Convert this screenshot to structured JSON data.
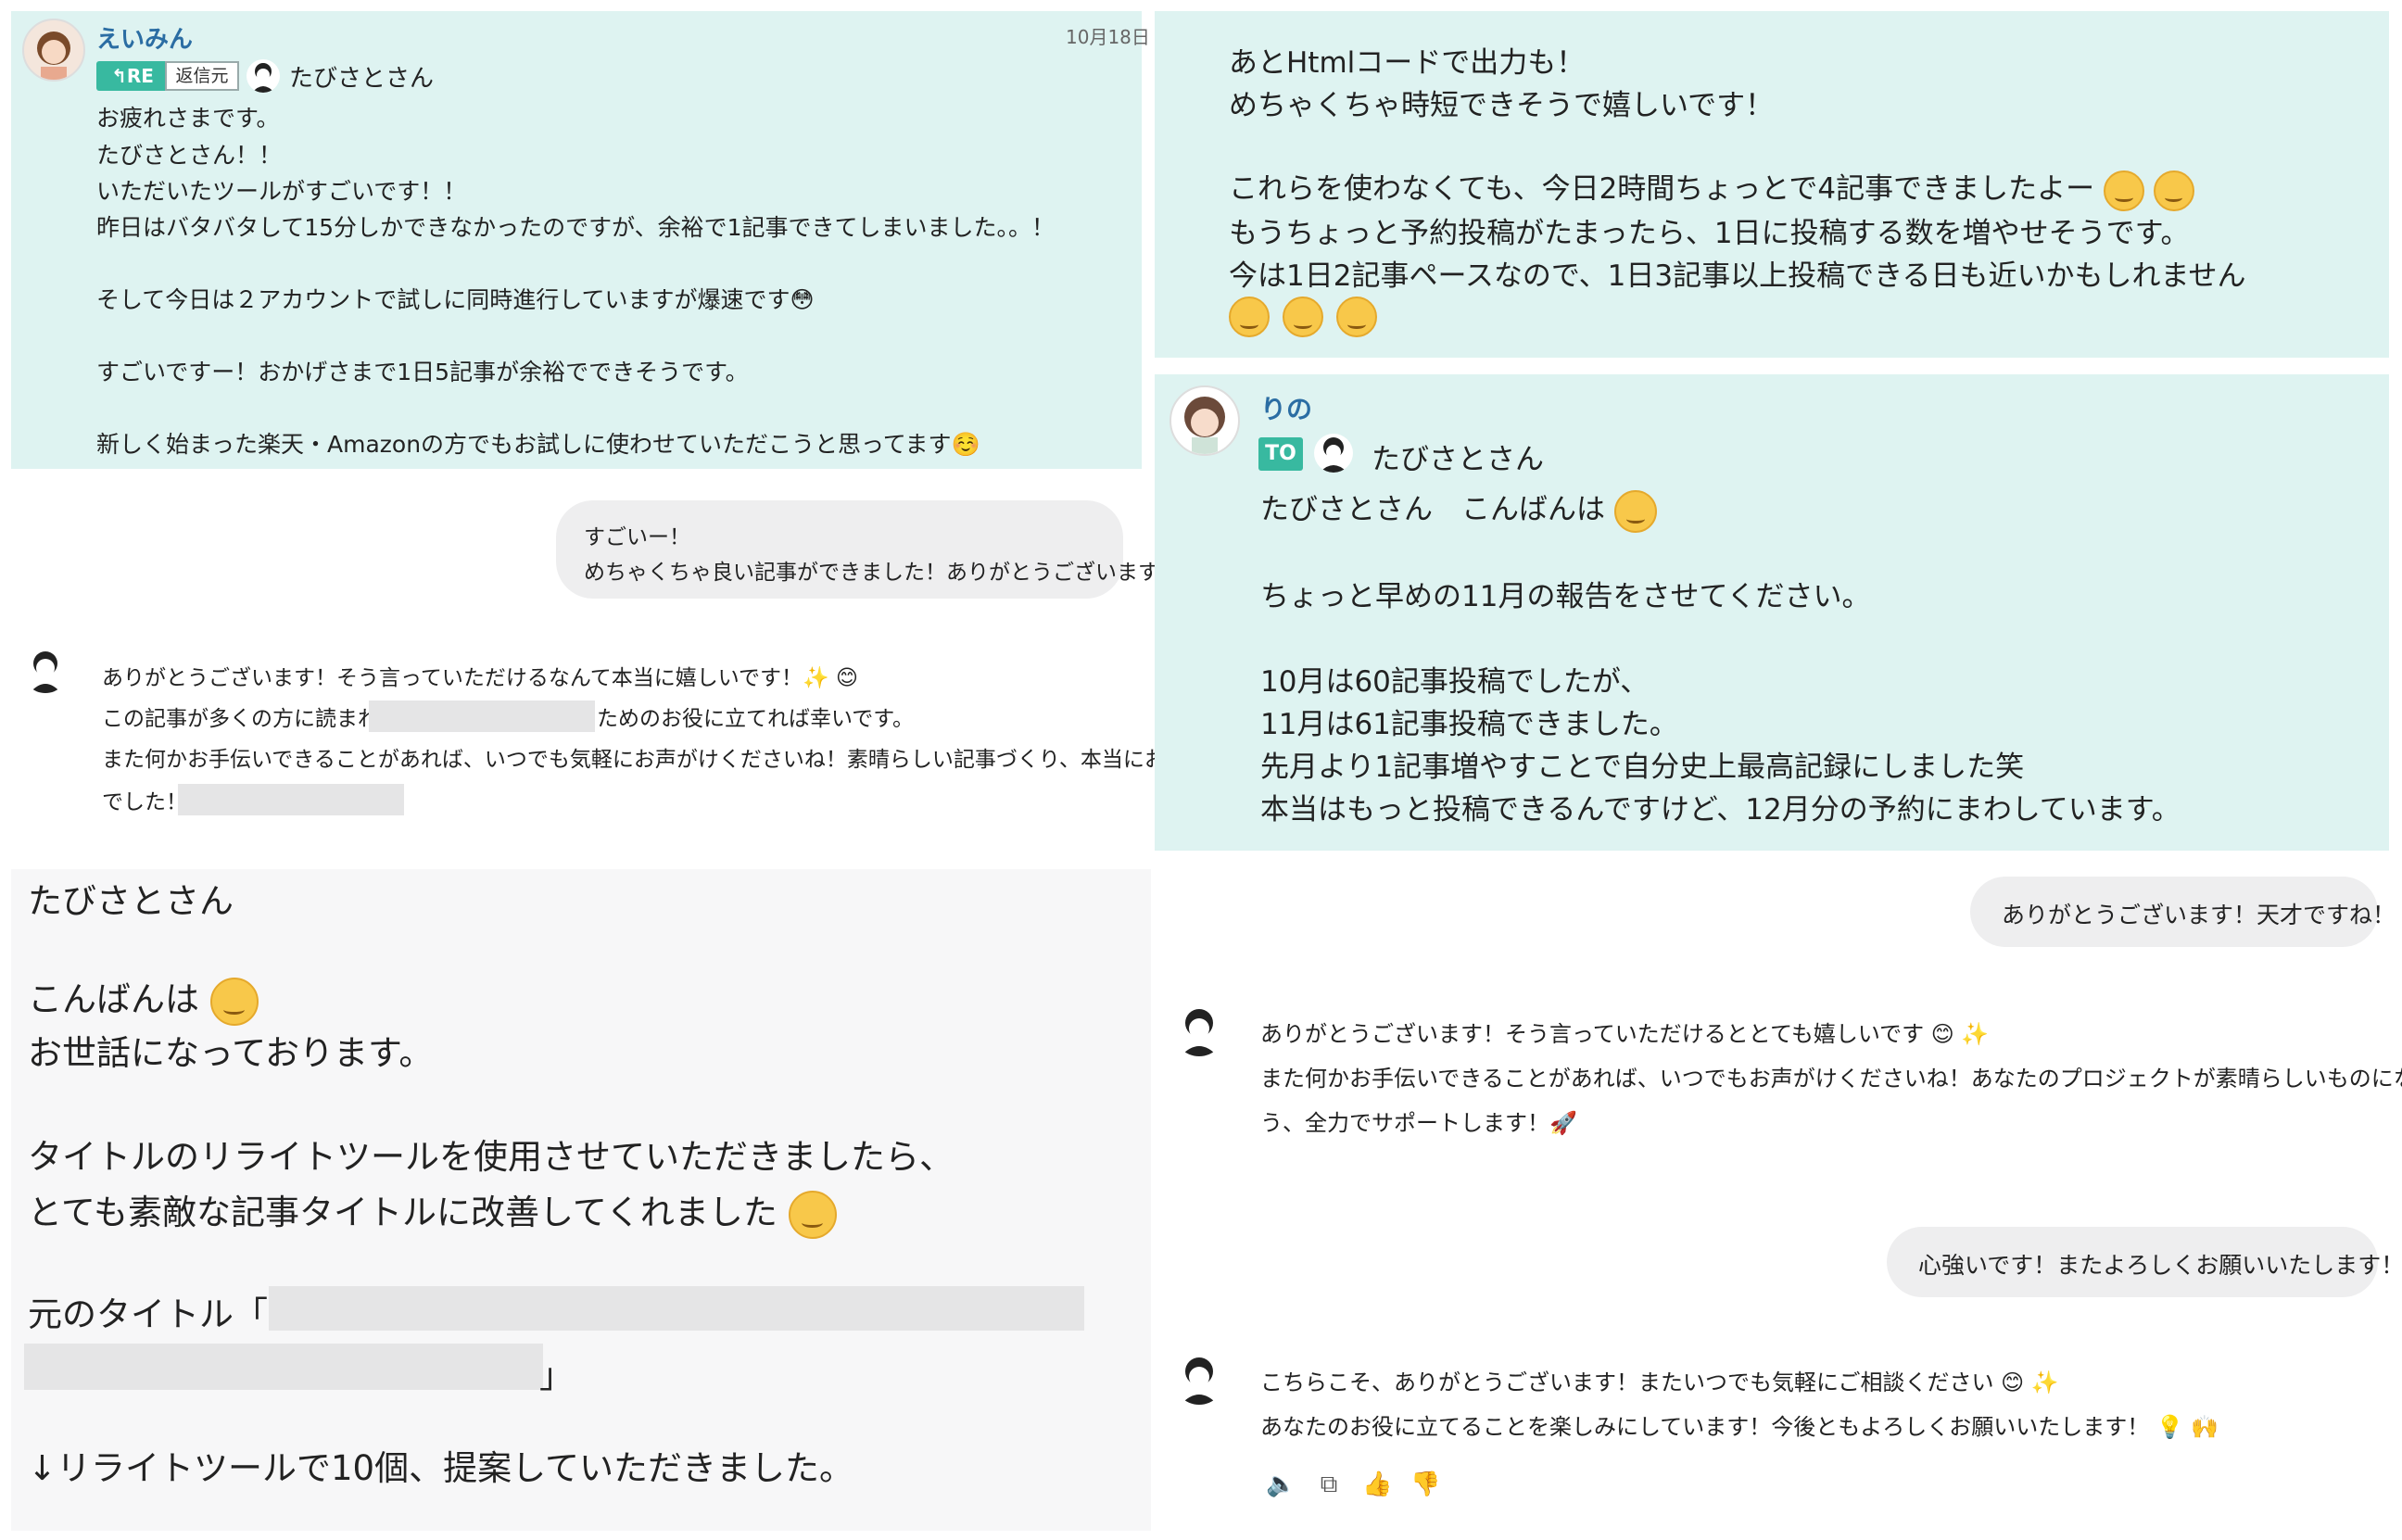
{
  "p1": {
    "name": "えいみん",
    "date": "10月18日",
    "re_badge": "RE",
    "re_label": "返信元",
    "reply_to": "たびさとさん",
    "lines": [
      "お疲れさまです。",
      "たびさとさん！！",
      "いただいたツールがすごいです！！",
      "昨日はバタバタして15分しかできなかったのですが、余裕で1記事できてしまいました。。！",
      "",
      "そして今日は２アカウントで試しに同時進行していますが爆速です😳",
      "",
      "すごいですー！おかげさまで1日5記事が余裕でできそうです。",
      "",
      "新しく始まった楽天・Amazonの方でもお試しに使わせていただこうと思ってます☺️"
    ]
  },
  "p2": {
    "user_bubble": [
      "すごいー！",
      "めちゃくちゃ良い記事ができました！ありがとうございます！"
    ],
    "bot_line1": "ありがとうございます！そう言っていただけるなんて本当に嬉しいです！✨ 😊",
    "bot_line2a": "この記事が多くの方に読まれ、",
    "bot_line2b": "ためのお役に立てれば幸いです。",
    "bot_line3": "また何かお手伝いできることがあれば、いつでも気軽にお声がけくださいね！素晴らしい記事づくり、本当にお疲れ様",
    "bot_line4": "でした！"
  },
  "p3": {
    "lines": [
      "たびさとさん",
      "こんばんは",
      "お世話になっております。",
      "タイトルのリライトツールを使用させていただきましたら、",
      "とても素敵な記事タイトルに改善してくれました",
      "元のタイトル「",
      "」",
      "↓リライトツールで10個、提案していただきました。"
    ]
  },
  "p4": {
    "lines": [
      "あとHtmlコードで出力も！",
      "めちゃくちゃ時短できそうで嬉しいです！",
      "これらを使わなくても、今日2時間ちょっとで4記事できましたよー",
      "もうちょっと予約投稿がたまったら、1日に投稿する数を増やせそうです。",
      "今は1日2記事ペースなので、1日3記事以上投稿できる日も近いかもしれません"
    ]
  },
  "p5": {
    "name": "りの",
    "to_badge": "TO",
    "to_name": "たびさとさん",
    "lines": [
      "たびさとさん　こんばんは",
      "ちょっと早めの11月の報告をさせてください。",
      "10月は60記事投稿でしたが、",
      "11月は61記事投稿できました。",
      "先月より1記事増やすことで自分史上最高記録にしました笑",
      "本当はもっと投稿できるんですけど、12月分の予約にまわしています。"
    ]
  },
  "p6": {
    "user1": "ありがとうございます！天才ですね！",
    "bot1_line1": "ありがとうございます！そう言っていただけるととても嬉しいです 😊 ✨",
    "bot1_line2": "また何かお手伝いできることがあれば、いつでもお声がけくださいね！あなたのプロジェクトが素晴らしいものになるよ",
    "bot1_line3": "う、全力でサポートします！🚀",
    "user2": "心強いです！またよろしくお願いいたします！",
    "bot2_line1": "こちらこそ、ありがとうございます！またいつでも気軽にご相談ください 😊 ✨",
    "bot2_line2": "あなたのお役に立てることを楽しみにしています！今後ともよろしくお願いいたします！ 💡 🙌",
    "icons": [
      "speaker-icon",
      "copy-icon",
      "thumbs-up-icon",
      "thumbs-down-icon"
    ]
  }
}
